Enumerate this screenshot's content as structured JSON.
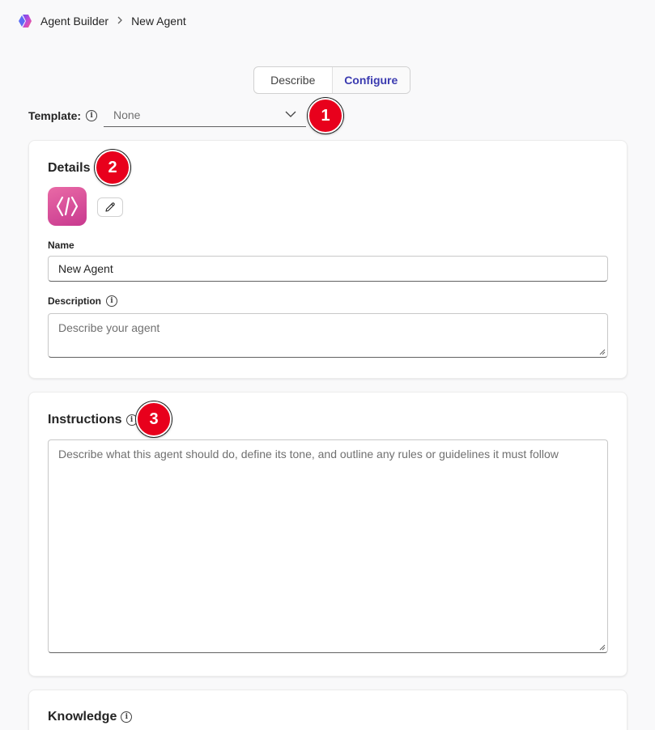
{
  "breadcrumb": {
    "app": "Agent Builder",
    "separator": ">",
    "current": "New Agent"
  },
  "tabs": [
    {
      "label": "Describe",
      "active": false
    },
    {
      "label": "Configure",
      "active": true
    }
  ],
  "template": {
    "label": "Template:",
    "value": "None"
  },
  "badges": [
    "1",
    "2",
    "3"
  ],
  "details": {
    "title": "Details",
    "name_label": "Name",
    "name_value": "New Agent",
    "description_label": "Description",
    "description_placeholder": "Describe your agent"
  },
  "instructions": {
    "title": "Instructions",
    "placeholder": "Describe what this agent should do, define its tone, and outline any rules or guidelines it must follow"
  },
  "knowledge": {
    "title": "Knowledge"
  },
  "colors": {
    "accent": "#3b3bb0",
    "badge": "#e8001c",
    "agent_icon": "#d84c9a"
  }
}
